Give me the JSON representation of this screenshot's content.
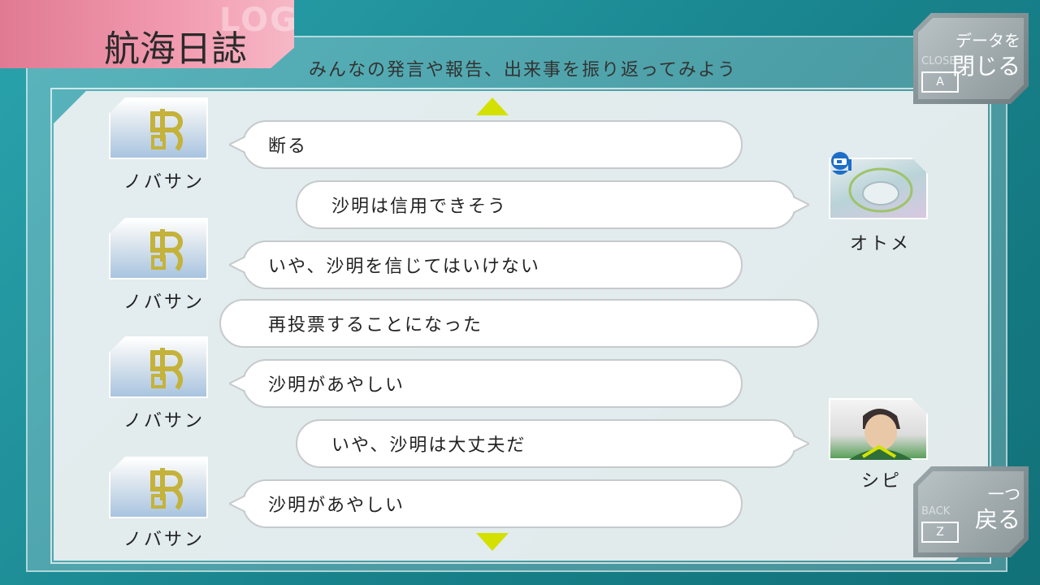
{
  "header": {
    "title": "航海日誌",
    "title_ghost": "LOG",
    "subtitle": "みんなの発言や報告、出来事を振り返ってみよう"
  },
  "close_button": {
    "small": "CLOSE",
    "top": "データを",
    "main": "閉じる",
    "key": "A"
  },
  "back_button": {
    "small": "BACK",
    "top": "一つ",
    "main": "戻る",
    "key": "Z"
  },
  "log": [
    {
      "speaker": "ノバサン",
      "side": "left",
      "text": "断る"
    },
    {
      "speaker": "オトメ",
      "side": "right",
      "text": "沙明は信用できそう"
    },
    {
      "speaker": "ノバサン",
      "side": "left",
      "text": "いや、沙明を信じてはいけない"
    },
    {
      "speaker": "",
      "side": "system",
      "text": "再投票することになった"
    },
    {
      "speaker": "ノバサン",
      "side": "left",
      "text": "沙明があやしい"
    },
    {
      "speaker": "シピ",
      "side": "right",
      "text": "いや、沙明は大丈夫だ"
    },
    {
      "speaker": "ノバサン",
      "side": "left",
      "text": "沙明があやしい"
    }
  ],
  "colors": {
    "accent_pink": "#f29bb0",
    "arrow_yellow": "#d4e100",
    "teal_bg": "#1d8a94"
  }
}
